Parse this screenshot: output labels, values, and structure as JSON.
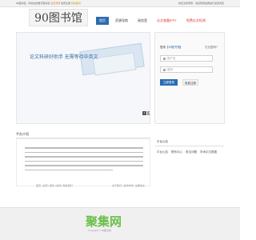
{
  "topbar": {
    "welcome": "90图书馆，你身边的数字图书馆",
    "link1": "会员登录",
    "link2": "免费注册",
    "link3": "我的藏书",
    "right": "你还没有登录，请您登录后再进行资源浏览"
  },
  "header": {
    "logo": "90图书馆",
    "nav": [
      "首页",
      "资源导航",
      "阅览室",
      "论文查重|PPT",
      "免费论文检测"
    ]
  },
  "banner": {
    "text": "论文科研好助手 无需等待中英文",
    "dots": [
      "1",
      "2"
    ]
  },
  "login": {
    "title_prefix": "登录【",
    "title_link": "90图书馆",
    "title_suffix": "】",
    "forgot": "忘记密码?",
    "username_placeholder": "用户名",
    "password_placeholder": "密码",
    "login_btn": "立即登录",
    "register_btn": "免费注册"
  },
  "lower": {
    "left_title": "平台介绍",
    "right_title": "平台公告",
    "right_links": [
      "平台公告",
      "联系中心",
      "常见问题",
      "学术论文数据"
    ],
    "links_left": "首页 | 资源 | 阅览 | 检测 | 联系我们",
    "links_right": "关于我们 | 合作伙伴 | 注册协议"
  },
  "footer": {
    "watermark": "聚集网",
    "sub": "Copyright © 90图书馆"
  }
}
